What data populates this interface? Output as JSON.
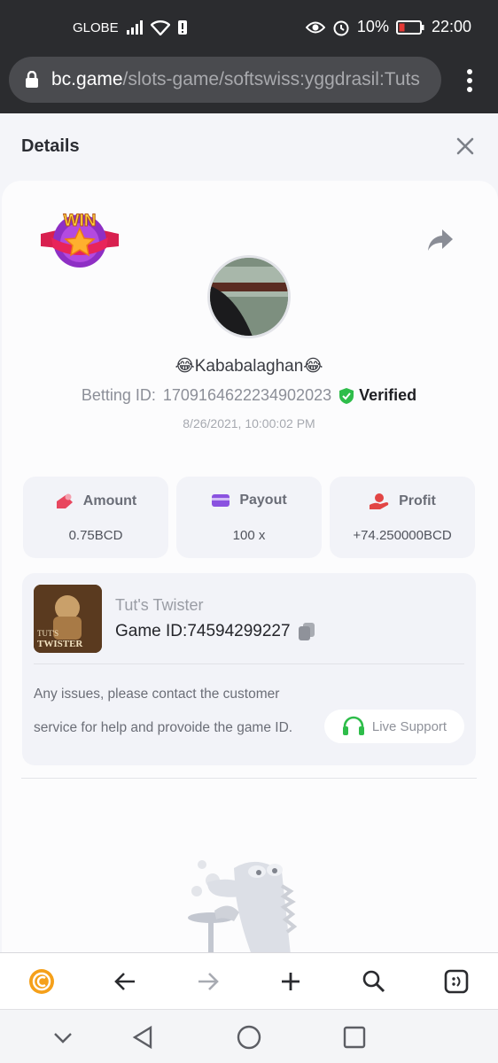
{
  "status_bar": {
    "carrier": "GLOBE",
    "battery": "10%",
    "time": "22:00"
  },
  "browser": {
    "url_host": "bc.game",
    "url_path": "/slots-game/softswiss:yggdrasil:Tuts"
  },
  "details": {
    "title": "Details"
  },
  "bet": {
    "win_badge_text": "WIN",
    "username": "😂Kababalaghan😂",
    "betting_id_label": "Betting ID:",
    "betting_id": "1709164622234902023",
    "verified_label": "Verified",
    "date": "8/26/2021, 10:00:02 PM"
  },
  "stats": [
    {
      "label": "Amount",
      "value": "0.75BCD"
    },
    {
      "label": "Payout",
      "value": "100 x"
    },
    {
      "label": "Profit",
      "value": "+74.250000BCD"
    }
  ],
  "game": {
    "thumb_text_1": "TUT'S",
    "thumb_text_2": "TWISTER",
    "name": "Tut's Twister",
    "id_label": "Game ID:",
    "id_value": "74594299227",
    "issue_text": "Any issues, please contact the customer service for help and provoide the game ID.",
    "live_support_label": "Live Support"
  },
  "colors": {
    "accent_green": "#2ebd4a",
    "amount_red": "#e8475f",
    "payout_purple": "#8a52e0",
    "profit_red": "#e24545",
    "coin_orange": "#f5a01a"
  },
  "icons": [
    "eye-icon",
    "alarm-icon",
    "battery-icon",
    "lock-icon",
    "more-vert-icon",
    "close-icon",
    "share-icon",
    "verified-shield-icon",
    "copy-icon",
    "headset-icon",
    "coin-icon",
    "back-arrow-icon",
    "forward-arrow-icon",
    "plus-icon",
    "search-icon",
    "tabs-icon",
    "chevron-down-icon",
    "nav-back-icon",
    "nav-home-icon",
    "nav-recents-icon"
  ]
}
